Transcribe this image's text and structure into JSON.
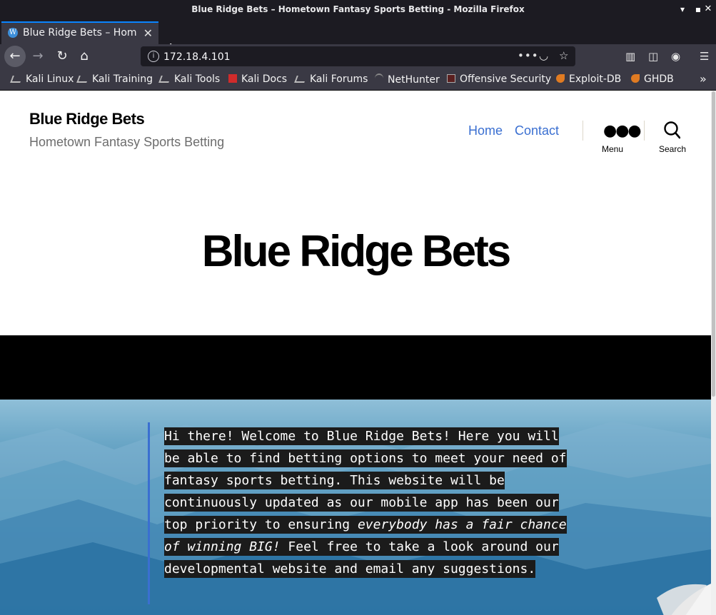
{
  "window": {
    "title": "Blue Ridge Bets – Hometown Fantasy Sports Betting - Mozilla Firefox"
  },
  "tab": {
    "label": "Blue Ridge Bets – Hometown Fantasy Sports Betting",
    "favicon": "wordpress-icon"
  },
  "urlbar": {
    "url": "172.18.4.101"
  },
  "bookmarks": [
    {
      "label": "Kali Linux",
      "icon": "kali-dragon-icon"
    },
    {
      "label": "Kali Training",
      "icon": "kali-dragon-icon"
    },
    {
      "label": "Kali Tools",
      "icon": "kali-dragon-icon"
    },
    {
      "label": "Kali Docs",
      "icon": "kali-docs-icon"
    },
    {
      "label": "Kali Forums",
      "icon": "kali-dragon-icon"
    },
    {
      "label": "NetHunter",
      "icon": "nethunter-icon"
    },
    {
      "label": "Offensive Security",
      "icon": "offsec-icon"
    },
    {
      "label": "Exploit-DB",
      "icon": "exploit-db-icon"
    },
    {
      "label": "GHDB",
      "icon": "exploit-db-icon"
    }
  ],
  "site": {
    "title": "Blue Ridge Bets",
    "description": "Hometown Fantasy Sports Betting",
    "nav": [
      "Home",
      "Contact"
    ],
    "menu_label": "Menu",
    "search_label": "Search"
  },
  "page": {
    "heading": "Blue Ridge Bets",
    "quote_parts": [
      " Hi there! Welcome to Blue Ridge Bets! Here you will be able to find betting options to meet your need of fantasy sports betting. This website will be continuously updated as our mobile app has been our top priority to ensuring ",
      "everybody has a fair chance of winning BIG!",
      " Feel free to take a look around our developmental website and email any suggestions."
    ]
  },
  "colors": {
    "accent": "#3a6fd1",
    "browser_dark": "#1c1b22",
    "toolbar": "#3a3944"
  }
}
